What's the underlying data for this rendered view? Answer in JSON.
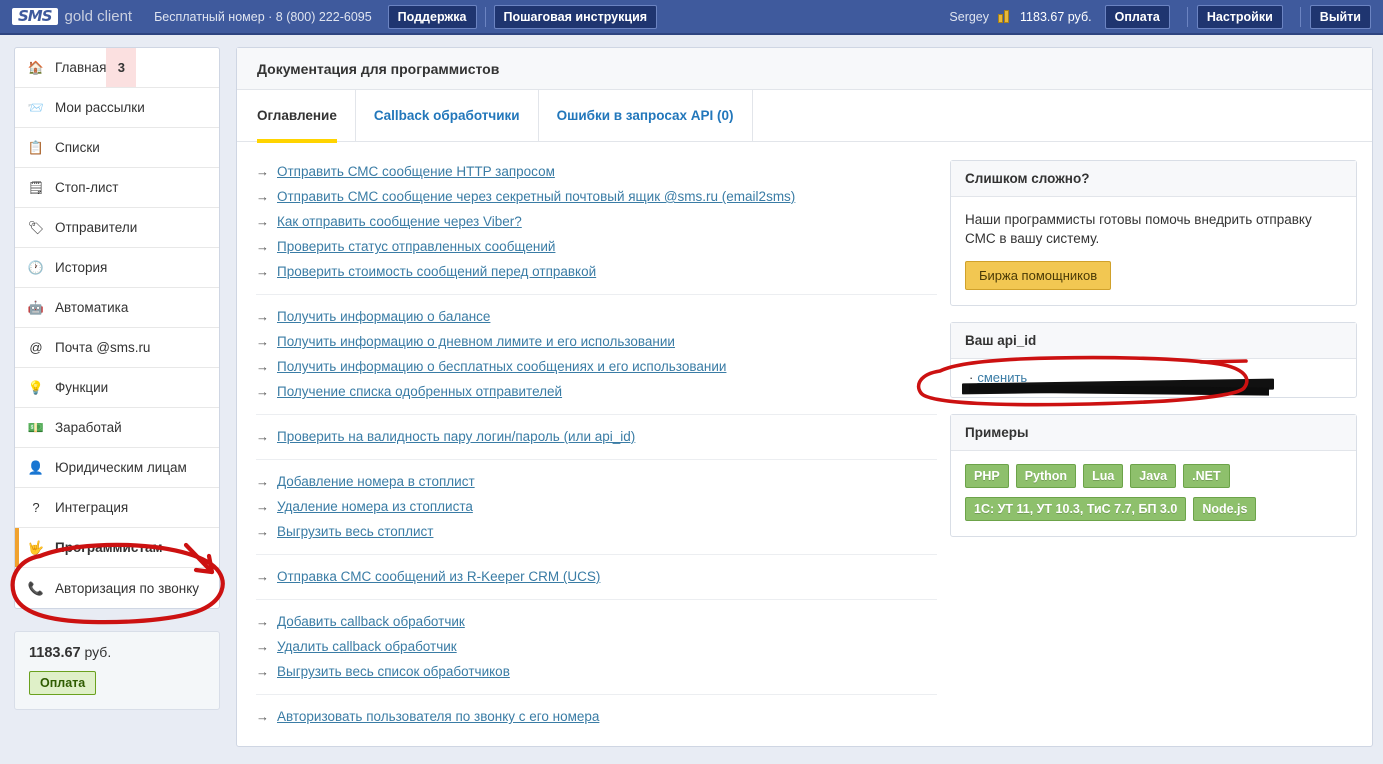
{
  "header": {
    "logo_sms": "SMS",
    "logo_gold": "gold client",
    "free_phone": "Бесплатный номер · 8 (800) 222-6095",
    "support_label": "Поддержка",
    "guide_label": "Пошаговая инструкция",
    "username": "Sergey",
    "balance": "1183.67 руб.",
    "pay_label": "Оплата",
    "settings_label": "Настройки",
    "logout_label": "Выйти",
    "coins_icon": "coins-icon"
  },
  "sidebar": {
    "items": [
      {
        "label": "Главная",
        "icon": "home-icon",
        "glyph": "🏠",
        "badge": "3",
        "active": false
      },
      {
        "label": "Мои рассылки",
        "icon": "mail-stack-icon",
        "glyph": "📨",
        "badge": "",
        "active": false
      },
      {
        "label": "Списки",
        "icon": "list-icon",
        "glyph": "📋",
        "badge": "",
        "active": false
      },
      {
        "label": "Стоп-лист",
        "icon": "stoplist-icon",
        "glyph": "🗒",
        "badge": "",
        "active": false
      },
      {
        "label": "Отправители",
        "icon": "tag-icon",
        "glyph": "🏷",
        "badge": "",
        "active": false
      },
      {
        "label": "История",
        "icon": "clock-icon",
        "glyph": "🕐",
        "badge": "",
        "active": false
      },
      {
        "label": "Автоматика",
        "icon": "robot-icon",
        "glyph": "🤖",
        "badge": "",
        "active": false
      },
      {
        "label": "Почта @sms.ru",
        "icon": "at-icon",
        "glyph": "@",
        "badge": "",
        "active": false
      },
      {
        "label": "Функции",
        "icon": "lightbulb-icon",
        "glyph": "💡",
        "badge": "",
        "active": false
      },
      {
        "label": "Заработай",
        "icon": "money-icon",
        "glyph": "💵",
        "badge": "",
        "active": false
      },
      {
        "label": "Юридическим лицам",
        "icon": "businessman-icon",
        "glyph": "👤",
        "badge": "",
        "active": false
      },
      {
        "label": "Интеграция",
        "icon": "question-icon",
        "glyph": "?",
        "badge": "",
        "active": false
      },
      {
        "label": "Программистам",
        "icon": "hand-icon",
        "glyph": "🤟",
        "badge": "",
        "active": true
      },
      {
        "label": "Авторизация по звонку",
        "icon": "phone-icon",
        "glyph": "📞",
        "badge": "",
        "active": false
      }
    ],
    "balance_amount": "1183.67",
    "balance_currency": "руб.",
    "pay_label": "Оплата"
  },
  "main": {
    "page_title": "Документация для программистов",
    "tabs": [
      {
        "label": "Оглавление",
        "active": true
      },
      {
        "label": "Callback обработчики",
        "active": false
      },
      {
        "label": "Ошибки в запросах API (0)",
        "active": false
      }
    ],
    "arrow": "→",
    "link_groups": [
      [
        "Отправить СМС сообщение HTTP запросом",
        "Отправить СМС сообщение через секретный почтовый ящик @sms.ru (email2sms)",
        "Как отправить сообщение через Viber?",
        "Проверить статус отправленных сообщений",
        "Проверить стоимость сообщений перед отправкой"
      ],
      [
        "Получить информацию о балансе",
        "Получить информацию о дневном лимите и его использовании",
        "Получить информацию о бесплатных сообщениях и его использовании",
        "Получение списка одобренных отправителей"
      ],
      [
        "Проверить на валидность пару логин/пароль (или api_id)"
      ],
      [
        "Добавление номера в стоплист",
        "Удаление номера из стоплиста",
        "Выгрузить весь стоплист"
      ],
      [
        "Отправка СМС сообщений из R-Keeper CRM (UCS)"
      ],
      [
        "Добавить callback обработчик",
        "Удалить callback обработчик",
        "Выгрузить весь список обработчиков"
      ],
      [
        "Авторизовать пользователя по звонку с его номера"
      ]
    ]
  },
  "side": {
    "help_card": {
      "title": "Слишком сложно?",
      "text": "Наши программисты готовы помочь внедрить отправку СМС в вашу систему.",
      "button": "Биржа помощников"
    },
    "apiid_card": {
      "title": "Ваш api_id",
      "value": "",
      "separator": "·",
      "change_link": "сменить"
    },
    "examples_card": {
      "title": "Примеры",
      "rows": [
        [
          "PHP",
          "Python",
          "Lua",
          "Java",
          ".NET"
        ],
        [
          "1C: УТ 11, УТ 10.3, ТиС 7.7, БП 3.0",
          "Node.js"
        ]
      ]
    }
  },
  "colors": {
    "header_bg": "#3f5a9d",
    "accent_tab": "#ffd400",
    "active_nav": "#f0a22e",
    "link": "#3a7ca5",
    "green_tag": "#8ec06c",
    "gold_btn": "#f2c752",
    "annotation": "#cc1111"
  },
  "annotations": {
    "circle_sidebar": "red-circle-programmers",
    "arrow_sidebar": "red-arrow-programmers",
    "circle_apiid": "red-circle-apiid"
  }
}
